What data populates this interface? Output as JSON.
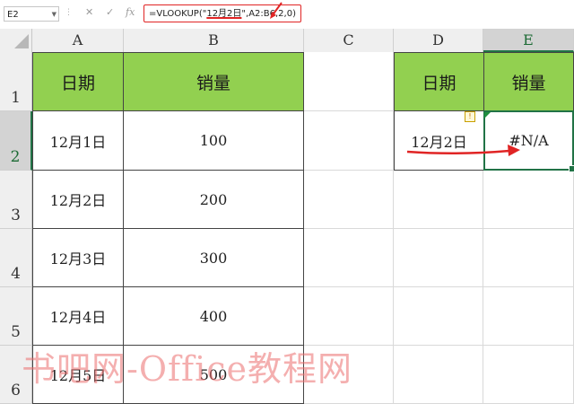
{
  "name_box": {
    "value": "E2"
  },
  "formula_bar": {
    "formula_pre": "=VLOOKUP(\"",
    "formula_hl": "12月2日",
    "formula_post": "\",A2:B6,2,0)",
    "cancel_icon": "✕",
    "confirm_icon": "✓",
    "fx_label": "fx"
  },
  "columns": [
    "A",
    "B",
    "C",
    "D",
    "E"
  ],
  "rows": [
    "1",
    "2",
    "3",
    "4",
    "5",
    "6"
  ],
  "table_left": {
    "headers": [
      "日期",
      "销量"
    ],
    "rows": [
      [
        "12月1日",
        "100"
      ],
      [
        "12月2日",
        "200"
      ],
      [
        "12月3日",
        "300"
      ],
      [
        "12月4日",
        "400"
      ],
      [
        "12月5日",
        "500"
      ]
    ]
  },
  "table_right": {
    "headers": [
      "日期",
      "销量"
    ],
    "lookup_date": "12月2日",
    "result": "#N/A"
  },
  "error_indicator": {
    "icon": "warning-icon",
    "glyph": "!"
  },
  "watermark": "书吧网-Office教程网",
  "colors": {
    "header_fill": "#92d050",
    "selection": "#217346",
    "annotation": "#e02424"
  }
}
